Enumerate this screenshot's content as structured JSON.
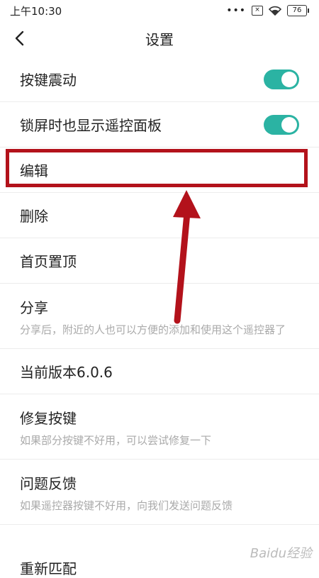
{
  "status_bar": {
    "time": "上午10:30",
    "dots": "•••",
    "sim": "×",
    "battery": "76"
  },
  "header": {
    "title": "设置"
  },
  "rows": {
    "vibrate": {
      "label": "按键震动",
      "on": true
    },
    "lockscreen": {
      "label": "锁屏时也显示遥控面板",
      "on": true
    },
    "edit": {
      "label": "编辑"
    },
    "delete": {
      "label": "删除"
    },
    "pin_top": {
      "label": "首页置顶"
    },
    "share": {
      "label": "分享",
      "desc": "分享后，附近的人也可以方便的添加和使用这个遥控器了"
    },
    "version": {
      "label": "当前版本6.0.6"
    },
    "repair": {
      "label": "修复按键",
      "desc": "如果部分按键不好用，可以尝试修复一下"
    },
    "feedback": {
      "label": "问题反馈",
      "desc": "如果遥控器按键不好用，向我们发送问题反馈"
    },
    "rematch": {
      "label": "重新匹配"
    }
  },
  "watermark": "Baidu经验",
  "colors": {
    "accent": "#2bb3a3",
    "highlight": "#b3121b"
  }
}
